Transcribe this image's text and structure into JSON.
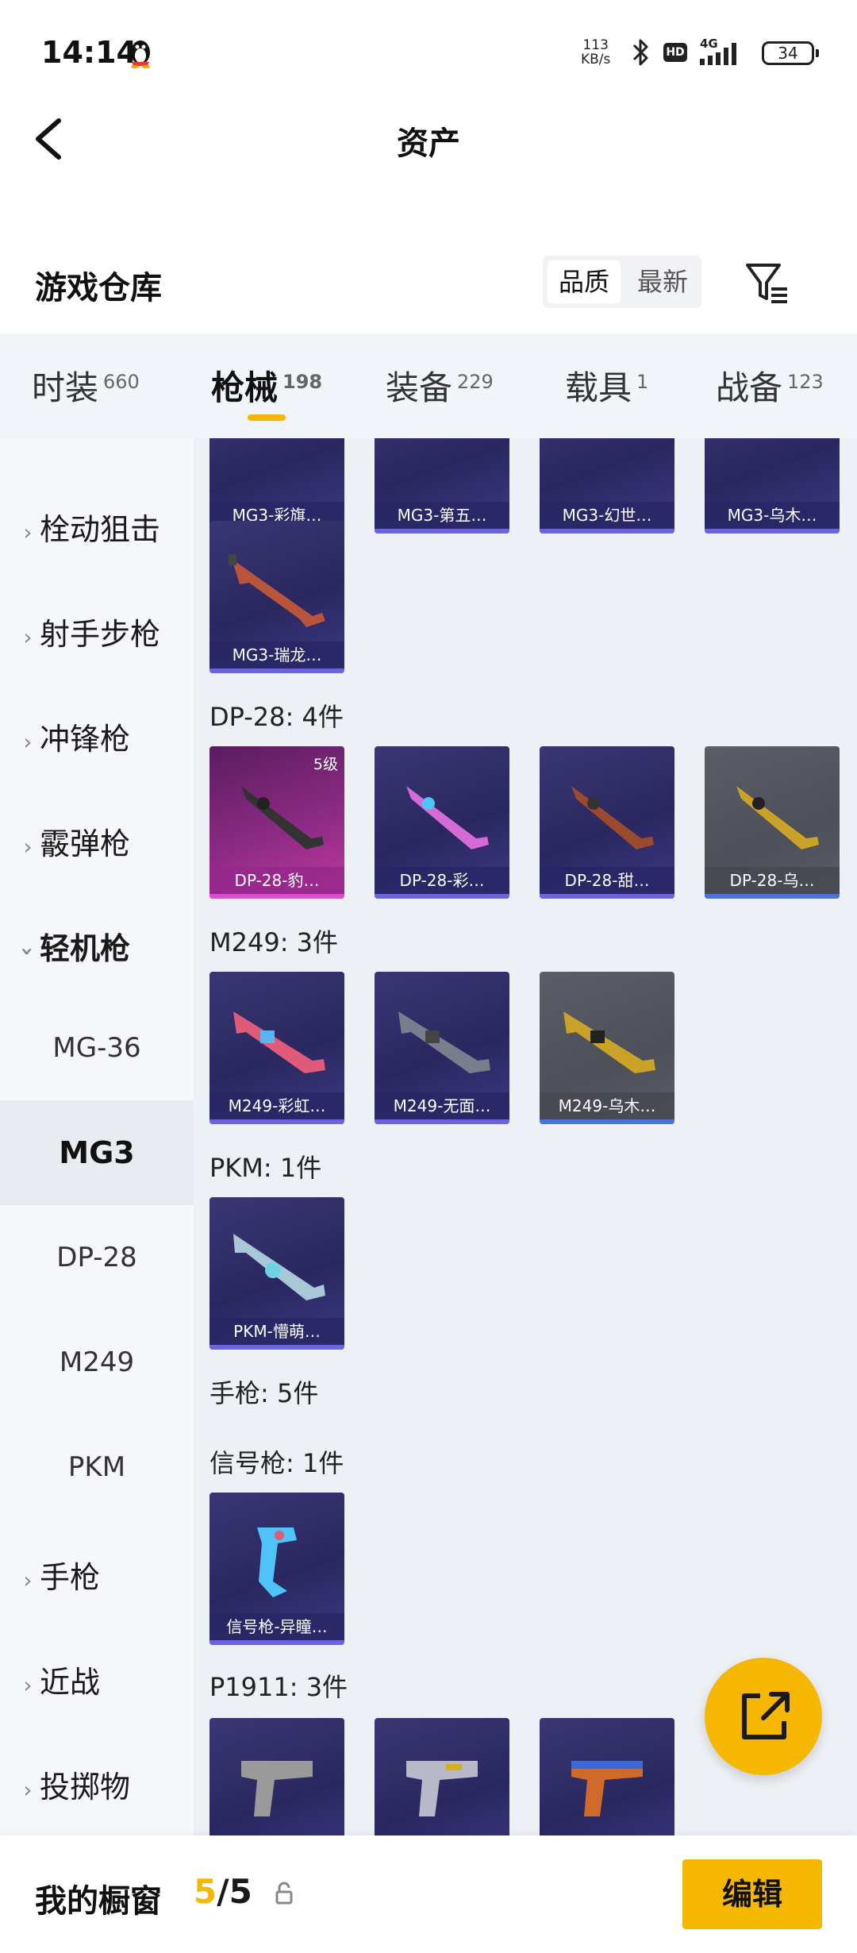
{
  "status_bar": {
    "time": "14:14",
    "net_speed_value": "113",
    "net_speed_unit": "KB/s",
    "hd": "HD",
    "signal": "4G",
    "battery": "34"
  },
  "header": {
    "title": "资产"
  },
  "store": {
    "title": "游戏仓库",
    "sort_quality": "品质",
    "sort_newest": "最新"
  },
  "tabs": [
    {
      "label": "时装",
      "count": "660"
    },
    {
      "label": "枪械",
      "count": "198"
    },
    {
      "label": "装备",
      "count": "229"
    },
    {
      "label": "载具",
      "count": "1"
    },
    {
      "label": "战备",
      "count": "123"
    }
  ],
  "sidebar": {
    "items": [
      "栓动狙击",
      "射手步枪",
      "冲锋枪",
      "霰弹枪",
      "轻机枪"
    ],
    "sub_items": [
      "MG-36",
      "MG3",
      "DP-28",
      "M249",
      "PKM"
    ],
    "items_after": [
      "手枪",
      "近战",
      "投掷物"
    ]
  },
  "content": {
    "mg3_top": [
      "MG3-彩旗…",
      "MG3-第五…",
      "MG3-幻世…",
      "MG3-乌木…"
    ],
    "mg3_last": "MG3-瑞龙…",
    "dp28": {
      "header": "DP-28: 4件",
      "items": [
        "DP-28-豹…",
        "DP-28-彩…",
        "DP-28-甜…",
        "DP-28-乌…"
      ],
      "level_badge": "5级"
    },
    "m249": {
      "header": "M249: 3件",
      "items": [
        "M249-彩虹…",
        "M249-无面…",
        "M249-乌木…"
      ]
    },
    "pkm": {
      "header": "PKM: 1件",
      "items": [
        "PKM-懵萌…"
      ]
    },
    "pistol_header": "手枪: 5件",
    "flare": {
      "header": "信号枪: 1件",
      "items": [
        "信号枪-异瞳…"
      ]
    },
    "p1911": {
      "header": "P1911: 3件"
    }
  },
  "bottom": {
    "label": "我的橱窗",
    "count_current": "5",
    "count_sep": "/",
    "count_total": "5",
    "edit": "编辑"
  },
  "colors": {
    "accent": "#f5b700",
    "card_purple": "#2a2760",
    "card_pink": "#8c2a84",
    "card_gray": "#4d5058"
  }
}
